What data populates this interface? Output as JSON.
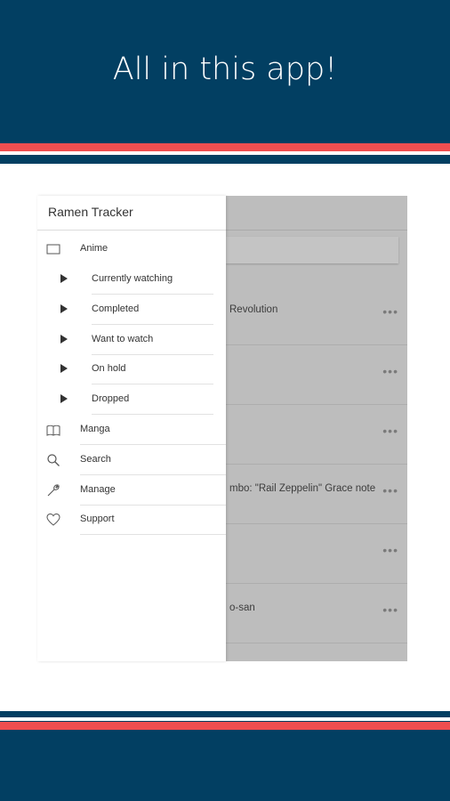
{
  "banner": {
    "title": "All in this app!"
  },
  "colors": {
    "band": "#023f62",
    "stripe": "#ef4e50"
  },
  "app": {
    "title": "Ramen Tracker",
    "nav": {
      "anime": {
        "label": "Anime",
        "icon": "monitor-icon"
      },
      "sub_items": [
        {
          "label": "Currently watching"
        },
        {
          "label": "Completed"
        },
        {
          "label": "Want to watch"
        },
        {
          "label": "On hold"
        },
        {
          "label": "Dropped"
        }
      ],
      "manga": {
        "label": "Manga",
        "icon": "book-icon"
      },
      "search": {
        "label": "Search",
        "icon": "search-icon"
      },
      "manage": {
        "label": "Manage",
        "icon": "wrench-icon"
      },
      "support": {
        "label": "Support",
        "icon": "heart-icon"
      }
    },
    "list": [
      {
        "text": "Revolution",
        "more": "•••"
      },
      {
        "text": "",
        "more": "•••"
      },
      {
        "text": "",
        "more": "•••"
      },
      {
        "text": "mbo: \"Rail Zeppelin\" Grace note",
        "more": "•••"
      },
      {
        "text": "",
        "more": "•••"
      },
      {
        "text": "o-san",
        "more": "•••"
      }
    ]
  }
}
